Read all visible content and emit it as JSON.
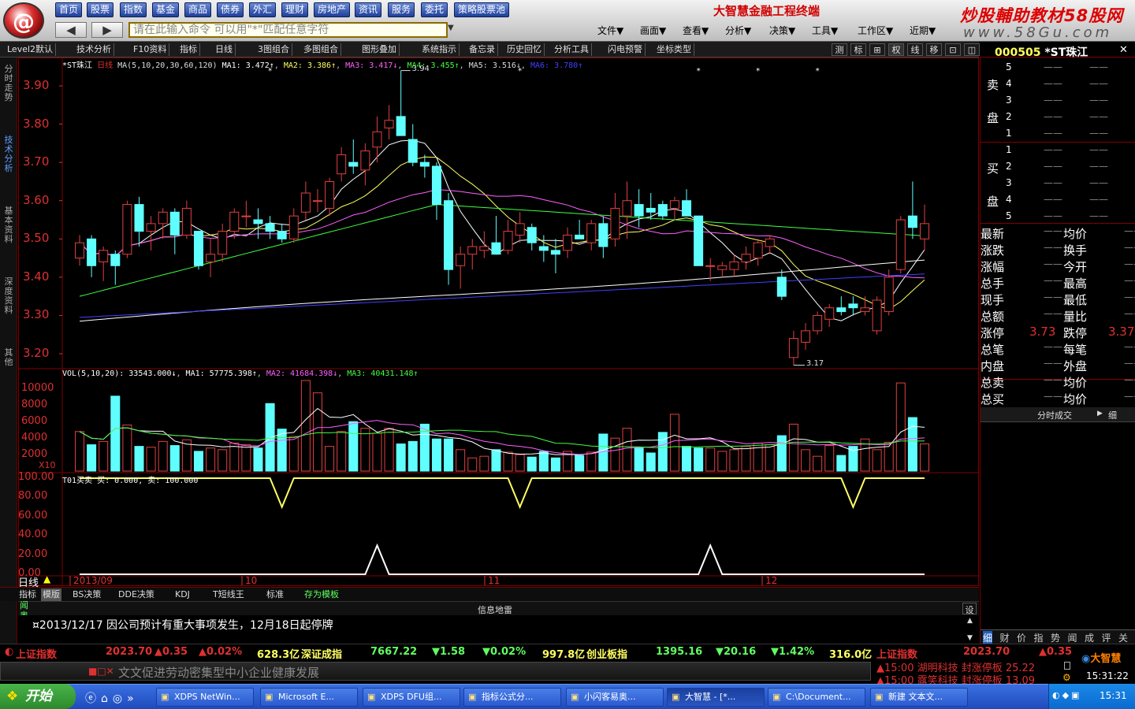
{
  "nav": [
    "首页",
    "股票",
    "指数",
    "基金",
    "商品",
    "债券",
    "外汇",
    "理财",
    "房地产",
    "资讯",
    "服务",
    "委托",
    "策略股票池"
  ],
  "command": {
    "placeholder": "请在此输入命令    可以用\"*\"匹配任意字符"
  },
  "brand": {
    "title": "大智慧金融工程终端",
    "watermark1": "炒股輔助教材58股网",
    "watermark2": "www.58Gu.com"
  },
  "menus": [
    "文件▼",
    "画面▼",
    "查看▼",
    "分析▼",
    "决策▼",
    "工具▼",
    "工作区▼",
    "近期▼"
  ],
  "toolbar": {
    "items": [
      "Level2默认",
      "技术分析",
      "F10资料",
      "指标",
      "日线",
      "3图组合",
      "多图组合",
      "图形叠加",
      "系统指示",
      "备忘录",
      "历史回忆",
      "分析工具",
      "闪电预警",
      "坐标类型"
    ],
    "right": [
      "测",
      "标",
      "⊞",
      "权",
      "线",
      "移",
      "⊡",
      "◫"
    ]
  },
  "stock": {
    "code": "000505",
    "name": "*ST珠江"
  },
  "lefttabs": [
    "分时走势",
    "技术分析",
    "基本资料",
    "深度资料",
    "其他"
  ],
  "chart_header": {
    "name": "*ST珠江",
    "period": "日线",
    "ma_def": "MA(5,10,20,30,60,120)",
    "ma1": "MA1: 3.472↑",
    "ma2": "MA2: 3.386↑",
    "ma3": "MA3: 3.417↓",
    "ma4": "MA4: 3.455↑",
    "ma5": "MA5: 3.516↓",
    "ma6": "MA6: 3.780↑"
  },
  "vol_header": {
    "def": "VOL(5,10,20): 33543.000↓",
    "ma1": "MA1: 57775.398↑",
    "ma2": "MA2: 41684.398↓",
    "ma3": "MA3: 40431.148↑"
  },
  "ind_header": {
    "text": "T01买卖  买: 0.000, 卖: 100.000"
  },
  "price_axis": [
    "3.90",
    "3.80",
    "3.70",
    "3.60",
    "3.50",
    "3.40",
    "3.30",
    "3.20"
  ],
  "vol_axis": [
    "10000",
    "8000",
    "6000",
    "4000",
    "2000"
  ],
  "vol_unit": "X10",
  "ind_axis": [
    "100.00",
    "80.00",
    "60.00",
    "40.00",
    "20.00",
    "0.00"
  ],
  "high_label": "3.94",
  "low_label": "3.17",
  "date_axis": [
    "2013/09",
    "10",
    "11",
    "12"
  ],
  "period_label": "日线",
  "colors": {
    "up": "#e04040",
    "down": "#60ffff",
    "ma1": "#ffffff",
    "ma2": "#ffff60",
    "ma3": "#ff60ff",
    "ma4": "#40ff40",
    "ma5": "#4040ff",
    "panel_red": "#800000"
  },
  "chart_data": [
    {
      "type": "candlestick",
      "title": "*ST珠江 日线",
      "ohlc": [
        [
          3.45,
          3.51,
          3.43,
          3.49
        ],
        [
          3.5,
          3.51,
          3.4,
          3.43
        ],
        [
          3.44,
          3.48,
          3.39,
          3.47
        ],
        [
          3.46,
          3.47,
          3.38,
          3.43
        ],
        [
          3.46,
          3.6,
          3.45,
          3.59
        ],
        [
          3.59,
          3.61,
          3.48,
          3.52
        ],
        [
          3.52,
          3.56,
          3.47,
          3.54
        ],
        [
          3.54,
          3.58,
          3.5,
          3.57
        ],
        [
          3.57,
          3.58,
          3.46,
          3.51
        ],
        [
          3.51,
          3.6,
          3.5,
          3.58
        ],
        [
          3.52,
          3.52,
          3.42,
          3.43
        ],
        [
          3.44,
          3.5,
          3.4,
          3.46
        ],
        [
          3.46,
          3.54,
          3.44,
          3.52
        ],
        [
          3.52,
          3.58,
          3.5,
          3.57
        ],
        [
          3.56,
          3.6,
          3.53,
          3.56
        ],
        [
          3.55,
          3.58,
          3.5,
          3.54
        ],
        [
          3.54,
          3.56,
          3.5,
          3.52
        ],
        [
          3.52,
          3.54,
          3.49,
          3.5
        ],
        [
          3.5,
          3.58,
          3.49,
          3.56
        ],
        [
          3.57,
          3.65,
          3.55,
          3.62
        ],
        [
          3.6,
          3.63,
          3.57,
          3.6
        ],
        [
          3.58,
          3.66,
          3.56,
          3.65
        ],
        [
          3.67,
          3.74,
          3.65,
          3.72
        ],
        [
          3.7,
          3.76,
          3.67,
          3.69
        ],
        [
          3.68,
          3.75,
          3.64,
          3.73
        ],
        [
          3.74,
          3.82,
          3.7,
          3.78
        ],
        [
          3.79,
          3.85,
          3.76,
          3.81
        ],
        [
          3.82,
          3.94,
          3.78,
          3.77
        ],
        [
          3.76,
          3.8,
          3.69,
          3.7
        ],
        [
          3.7,
          3.72,
          3.66,
          3.69
        ],
        [
          3.69,
          3.7,
          3.55,
          3.59
        ],
        [
          3.6,
          3.62,
          3.38,
          3.42
        ],
        [
          3.43,
          3.48,
          3.37,
          3.46
        ],
        [
          3.46,
          3.5,
          3.42,
          3.48
        ],
        [
          3.47,
          3.52,
          3.45,
          3.48
        ],
        [
          3.49,
          3.56,
          3.47,
          3.46
        ],
        [
          3.47,
          3.55,
          3.46,
          3.52
        ],
        [
          3.51,
          3.57,
          3.49,
          3.54
        ],
        [
          3.53,
          3.54,
          3.47,
          3.49
        ],
        [
          3.48,
          3.51,
          3.44,
          3.47
        ],
        [
          3.47,
          3.5,
          3.41,
          3.46
        ],
        [
          3.47,
          3.53,
          3.45,
          3.51
        ],
        [
          3.51,
          3.55,
          3.5,
          3.5
        ],
        [
          3.49,
          3.55,
          3.47,
          3.54
        ],
        [
          3.54,
          3.56,
          3.45,
          3.48
        ],
        [
          3.5,
          3.62,
          3.48,
          3.58
        ],
        [
          3.56,
          3.65,
          3.5,
          3.6
        ],
        [
          3.59,
          3.63,
          3.53,
          3.56
        ],
        [
          3.58,
          3.62,
          3.55,
          3.57
        ],
        [
          3.59,
          3.6,
          3.55,
          3.56
        ],
        [
          3.58,
          3.61,
          3.55,
          3.6
        ],
        [
          3.6,
          3.63,
          3.56,
          3.56
        ],
        [
          3.56,
          3.56,
          3.43,
          3.43
        ],
        [
          3.43,
          3.45,
          3.39,
          3.43
        ],
        [
          3.42,
          3.44,
          3.4,
          3.43
        ],
        [
          3.42,
          3.46,
          3.4,
          3.44
        ],
        [
          3.44,
          3.48,
          3.42,
          3.46
        ],
        [
          3.45,
          3.5,
          3.43,
          3.49
        ],
        [
          3.48,
          3.51,
          3.46,
          3.5
        ],
        [
          3.4,
          3.42,
          3.34,
          3.35
        ],
        [
          3.19,
          3.26,
          3.17,
          3.24
        ],
        [
          3.23,
          3.28,
          3.21,
          3.26
        ],
        [
          3.26,
          3.31,
          3.25,
          3.3
        ],
        [
          3.29,
          3.33,
          3.27,
          3.32
        ],
        [
          3.32,
          3.35,
          3.3,
          3.31
        ],
        [
          3.33,
          3.35,
          3.3,
          3.32
        ],
        [
          3.31,
          3.35,
          3.3,
          3.32
        ],
        [
          3.26,
          3.35,
          3.25,
          3.34
        ],
        [
          3.31,
          3.42,
          3.3,
          3.4
        ],
        [
          3.42,
          3.56,
          3.41,
          3.55
        ],
        [
          3.56,
          3.65,
          3.5,
          3.53
        ],
        [
          3.5,
          3.59,
          3.47,
          3.54
        ]
      ],
      "volume": [
        4800,
        3200,
        3600,
        9100,
        5600,
        3000,
        2900,
        3600,
        3100,
        3800,
        2400,
        2800,
        2600,
        3400,
        3200,
        2800,
        8200,
        5100,
        4200,
        11000,
        9500,
        3000,
        4800,
        6000,
        5200,
        4600,
        5200,
        3300,
        3600,
        5700,
        3900,
        3900,
        2600,
        1600,
        1800,
        2600,
        2300,
        2000,
        1700,
        2400,
        1600,
        2400,
        1900,
        2300,
        4500,
        4000,
        5200,
        2800,
        2200,
        4700,
        6900,
        3000,
        2800,
        2800,
        2400,
        2600,
        3000,
        3400,
        3200,
        4300,
        5700,
        2600,
        1800,
        3100,
        1900,
        3000,
        3900,
        2600,
        3500,
        10700,
        6500,
        3300
      ],
      "ylim": [
        3.15,
        3.97
      ]
    },
    {
      "type": "line",
      "title": "T01买卖",
      "series": [
        {
          "name": "买",
          "points": [
            [
              0,
              0
            ],
            [
              24,
              0
            ],
            [
              25,
              30
            ],
            [
              26,
              0
            ],
            [
              52,
              0
            ],
            [
              53,
              30
            ],
            [
              54,
              0
            ],
            [
              71,
              0
            ]
          ]
        },
        {
          "name": "卖",
          "points": [
            [
              0,
              100
            ],
            [
              16,
              100
            ],
            [
              17,
              70
            ],
            [
              18,
              100
            ],
            [
              36,
              100
            ],
            [
              37,
              70
            ],
            [
              38,
              100
            ],
            [
              64,
              100
            ],
            [
              65,
              70
            ],
            [
              66,
              100
            ],
            [
              71,
              100
            ]
          ]
        }
      ],
      "ylim": [
        0,
        100
      ]
    }
  ],
  "bottom_tabs": [
    "指标",
    "模版",
    "BS决策",
    "DDE决策",
    "KDJ",
    "T短线王",
    "标准",
    "存为模板"
  ],
  "info_title": "信息地雷",
  "info_side": "设",
  "side_vertical": [
    "闻",
    "奥",
    "行",
    "析"
  ],
  "news": "¤2013/12/17  因公司预计有重大事项发生，12月18日起停牌",
  "rp": {
    "sell_label": [
      "卖",
      "盘"
    ],
    "buy_label": [
      "买",
      "盘"
    ],
    "sell_levels": [
      "5",
      "4",
      "3",
      "2",
      "1"
    ],
    "buy_levels": [
      "1",
      "2",
      "3",
      "4",
      "5"
    ],
    "dash": "——",
    "stats": [
      [
        "最新",
        "——",
        "均价",
        "——"
      ],
      [
        "涨跌",
        "——",
        "换手",
        "——"
      ],
      [
        "涨幅",
        "——",
        "今开",
        "——"
      ],
      [
        "总手",
        "——",
        "最高",
        "——"
      ],
      [
        "现手",
        "——",
        "最低",
        "——"
      ],
      [
        "总额",
        "——",
        "量比",
        "——"
      ],
      [
        "涨停",
        "3.73",
        "跌停",
        "3.37"
      ],
      [
        "总笔",
        "——",
        "每笔",
        "——"
      ],
      [
        "内盘",
        "——",
        "外盘",
        "——"
      ],
      [
        "总卖",
        "——",
        "均价",
        "——"
      ],
      [
        "总买",
        "——",
        "均价",
        "——"
      ]
    ],
    "fsc": "分时成交",
    "fsc_side": "细",
    "bottom_tabs": [
      "细",
      "财",
      "价",
      "指",
      "势",
      "闻",
      "成",
      "评",
      "关"
    ]
  },
  "ticker": {
    "sh1": "上证指数",
    "sh1v": "2023.70",
    "sh1c": "▲0.35",
    "sh1p": "▲0.02%",
    "amt1": "628.3亿",
    "sz": "深证成指",
    "szv": "7667.22",
    "szc": "▼1.58",
    "szp": "▼0.02%",
    "amt2": "997.8亿",
    "cyb": "创业板指",
    "cybv": "1395.16",
    "cybc": "▼20.16",
    "cybp": "▼1.42%",
    "amt3": "316.0亿",
    "sh2": "上证指数",
    "sh2v": "2023.70",
    "sh2c": "▲0.35"
  },
  "scroll_news": "文文促进劳动密集型中小企业健康发展",
  "alerts": [
    "▲15:00 湖明科技 封涨停板 25.22",
    "▲15:00 露笑科技 封涨停板 13.09"
  ],
  "clock": "15:31:22",
  "logo2": "大智慧",
  "taskbar": {
    "start": "开始",
    "tasks": [
      "XDPS NetWin...",
      "Microsoft E...",
      "XDPS DFU组...",
      "指标公式分...",
      "小闪客易奥...",
      "大智慧 - [*...",
      "C:\\Document...",
      "新建 文本文..."
    ],
    "time": "15:31"
  }
}
